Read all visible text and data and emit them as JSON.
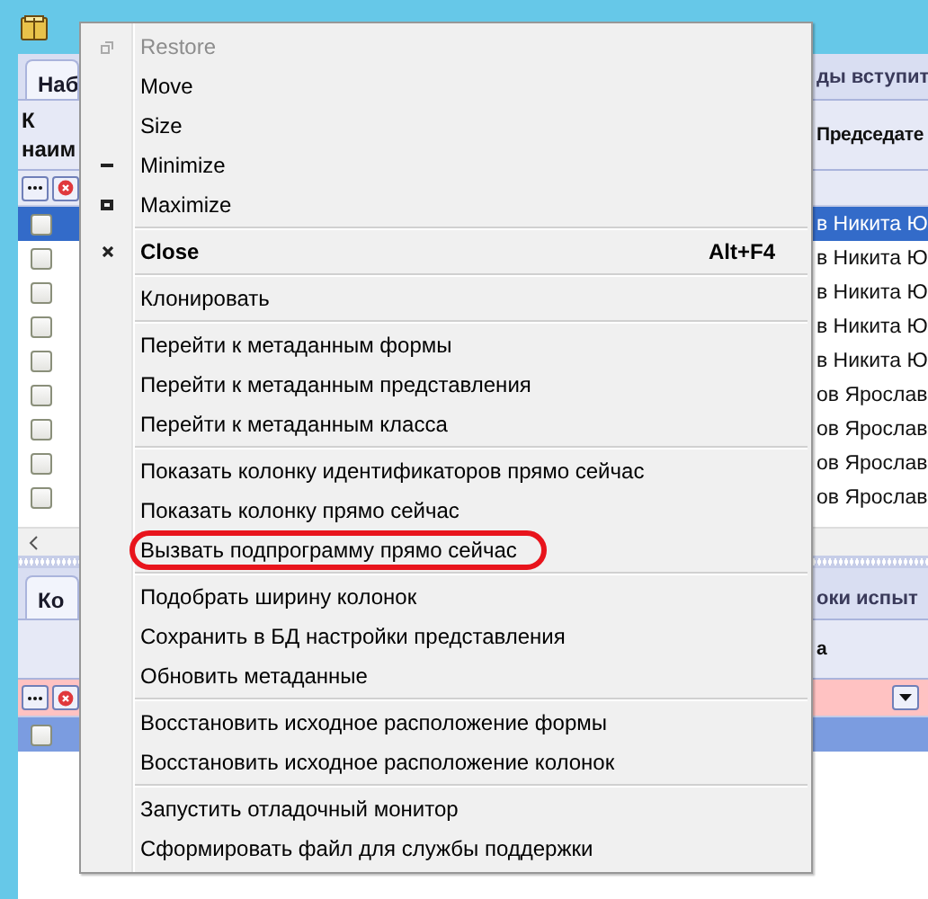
{
  "top_panel": {
    "tab": {
      "label": "Наб",
      "selected": true
    },
    "caption": "ды вступит",
    "header_lines": [
      "К",
      "наим"
    ],
    "column_2": "Председате",
    "rows": [
      {
        "selected": true,
        "checked": false,
        "column_2": "в Никита Ю"
      },
      {
        "selected": false,
        "checked": false,
        "column_2": "в Никита Ю"
      },
      {
        "selected": false,
        "checked": false,
        "column_2": "в Никита Ю"
      },
      {
        "selected": false,
        "checked": false,
        "column_2": "в Никита Ю"
      },
      {
        "selected": false,
        "checked": false,
        "column_2": "в Никита Ю"
      },
      {
        "selected": false,
        "checked": false,
        "column_2": "ов Ярослав"
      },
      {
        "selected": false,
        "checked": false,
        "column_2": "ов Ярослав"
      },
      {
        "selected": false,
        "checked": false,
        "column_2": "ов Ярослав"
      },
      {
        "selected": false,
        "checked": false,
        "column_2": "ов Ярослав"
      }
    ]
  },
  "bottom_panel": {
    "tab": {
      "label": "Ко",
      "selected": true
    },
    "caption": "оки испыт",
    "column_2": "а",
    "rows": [
      {
        "selected": true,
        "checked": false
      }
    ]
  },
  "context_menu": {
    "items": [
      {
        "kind": "restore",
        "label": "Restore",
        "disabled": true
      },
      {
        "kind": "move",
        "label": "Move",
        "disabled": false
      },
      {
        "kind": "size",
        "label": "Size",
        "disabled": false
      },
      {
        "kind": "minimize",
        "label": "Minimize",
        "disabled": false
      },
      {
        "kind": "maximize",
        "label": "Maximize",
        "disabled": false
      },
      {
        "kind": "separator"
      },
      {
        "kind": "close",
        "label": "Close",
        "shortcut": "Alt+F4",
        "disabled": false
      },
      {
        "kind": "separator"
      },
      {
        "kind": "command",
        "label": "Клонировать",
        "disabled": false
      },
      {
        "kind": "separator"
      },
      {
        "kind": "command",
        "label": "Перейти к метаданным формы",
        "disabled": false
      },
      {
        "kind": "command",
        "label": "Перейти к метаданным представления",
        "disabled": false
      },
      {
        "kind": "command",
        "label": "Перейти к метаданным класса",
        "disabled": false
      },
      {
        "kind": "separator"
      },
      {
        "kind": "command",
        "label": "Показать колонку идентификаторов прямо сейчас",
        "disabled": false
      },
      {
        "kind": "command",
        "label": "Показать колонку прямо сейчас",
        "disabled": false
      },
      {
        "kind": "command",
        "label": "Вызвать подпрограмму прямо сейчас",
        "disabled": false,
        "circled": true
      },
      {
        "kind": "separator"
      },
      {
        "kind": "command",
        "label": "Подобрать ширину колонок",
        "disabled": false
      },
      {
        "kind": "command",
        "label": "Сохранить в БД настройки представления",
        "disabled": false
      },
      {
        "kind": "command",
        "label": "Обновить метаданные",
        "disabled": false
      },
      {
        "kind": "separator"
      },
      {
        "kind": "command",
        "label": "Восстановить исходное расположение формы",
        "disabled": false
      },
      {
        "kind": "command",
        "label": "Восстановить исходное расположение колонок",
        "disabled": false
      },
      {
        "kind": "separator"
      },
      {
        "kind": "command",
        "label": "Запустить отладочный монитор",
        "disabled": false
      },
      {
        "kind": "command",
        "label": "Сформировать файл для службы поддержки",
        "disabled": false
      }
    ]
  }
}
